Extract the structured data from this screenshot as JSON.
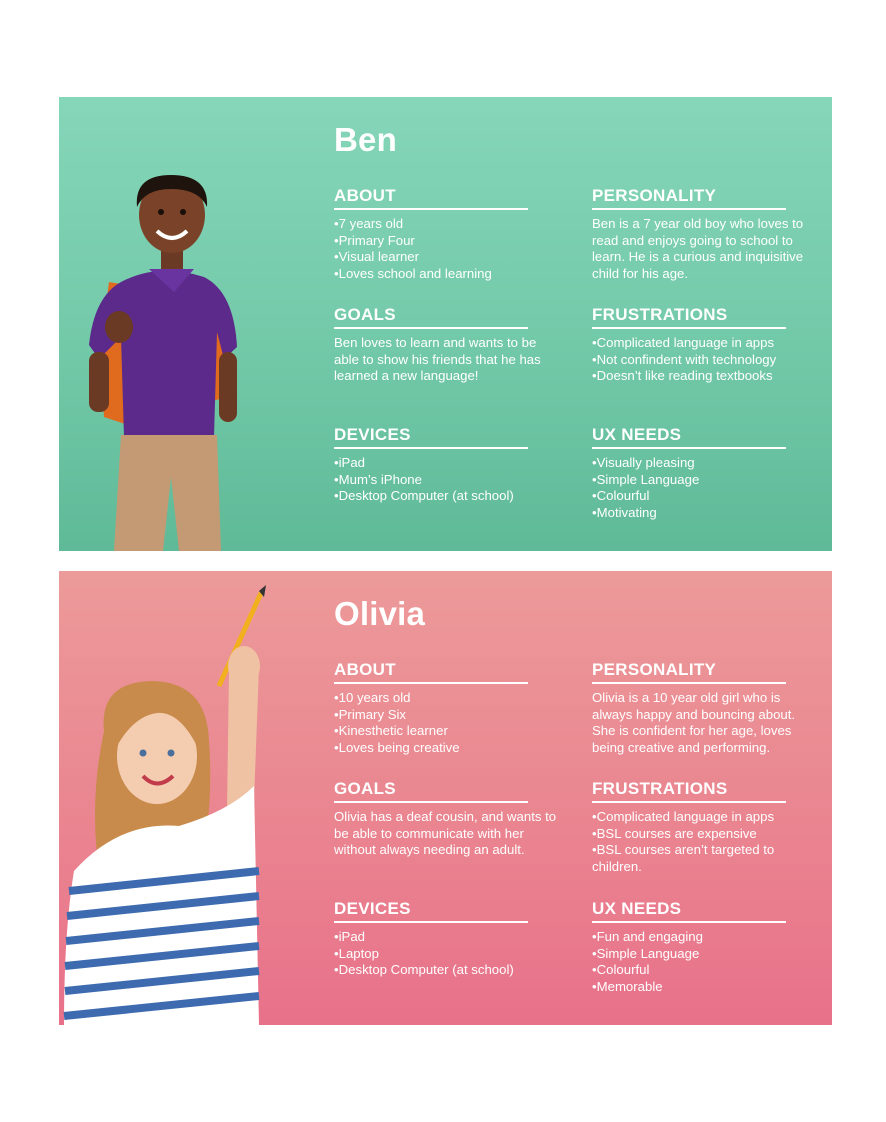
{
  "personas": [
    {
      "name": "Ben",
      "about": {
        "title": "ABOUT",
        "items": [
          "7 years old",
          "Primary Four",
          "Visual learner",
          "Loves school and learning"
        ]
      },
      "personality": {
        "title": "PERSONALITY",
        "text": "Ben is a 7 year old boy who loves to read and enjoys going to school to learn. He is a curious and inquisitive child for his age."
      },
      "goals": {
        "title": "GOALS",
        "text": "Ben loves to learn and wants to be able to show his friends that he has learned a new language!"
      },
      "frustrations": {
        "title": "FRUSTRATIONS",
        "items": [
          "Complicated language in apps",
          "Not confindent with technology",
          "Doesn’t like reading textbooks"
        ]
      },
      "devices": {
        "title": "DEVICES",
        "items": [
          "iPad",
          "Mum’s iPhone",
          "Desktop Computer (at school)"
        ]
      },
      "ux_needs": {
        "title": "UX NEEDS",
        "items": [
          "Visually pleasing",
          "Simple Language",
          "Colourful",
          "Motivating"
        ]
      }
    },
    {
      "name": "Olivia",
      "about": {
        "title": "ABOUT",
        "items": [
          "10 years old",
          "Primary Six",
          "Kinesthetic learner",
          "Loves being creative"
        ]
      },
      "personality": {
        "title": "PERSONALITY",
        "text": "Olivia is a 10 year old girl who is always happy and bouncing about. She is confident for her age, loves being creative and performing."
      },
      "goals": {
        "title": "GOALS",
        "text": "Olivia has a deaf cousin, and wants to be able to communicate with her without always needing an adult."
      },
      "frustrations": {
        "title": "FRUSTRATIONS",
        "items": [
          "Complicated language in apps",
          "BSL courses are expensive",
          "BSL courses aren’t targeted to children."
        ]
      },
      "devices": {
        "title": "DEVICES",
        "items": [
          "iPad",
          "Laptop",
          "Desktop Computer (at school)"
        ]
      },
      "ux_needs": {
        "title": "UX NEEDS",
        "items": [
          "Fun and engaging",
          "Simple Language",
          "Colourful",
          "Memorable"
        ]
      }
    }
  ],
  "colors": {
    "ben_card_top": "#86d6ba",
    "ben_card_bottom": "#5fba98",
    "olivia_card_top": "#ec9a9a",
    "olivia_card_bottom": "#e8718a",
    "text": "#ffffff"
  }
}
